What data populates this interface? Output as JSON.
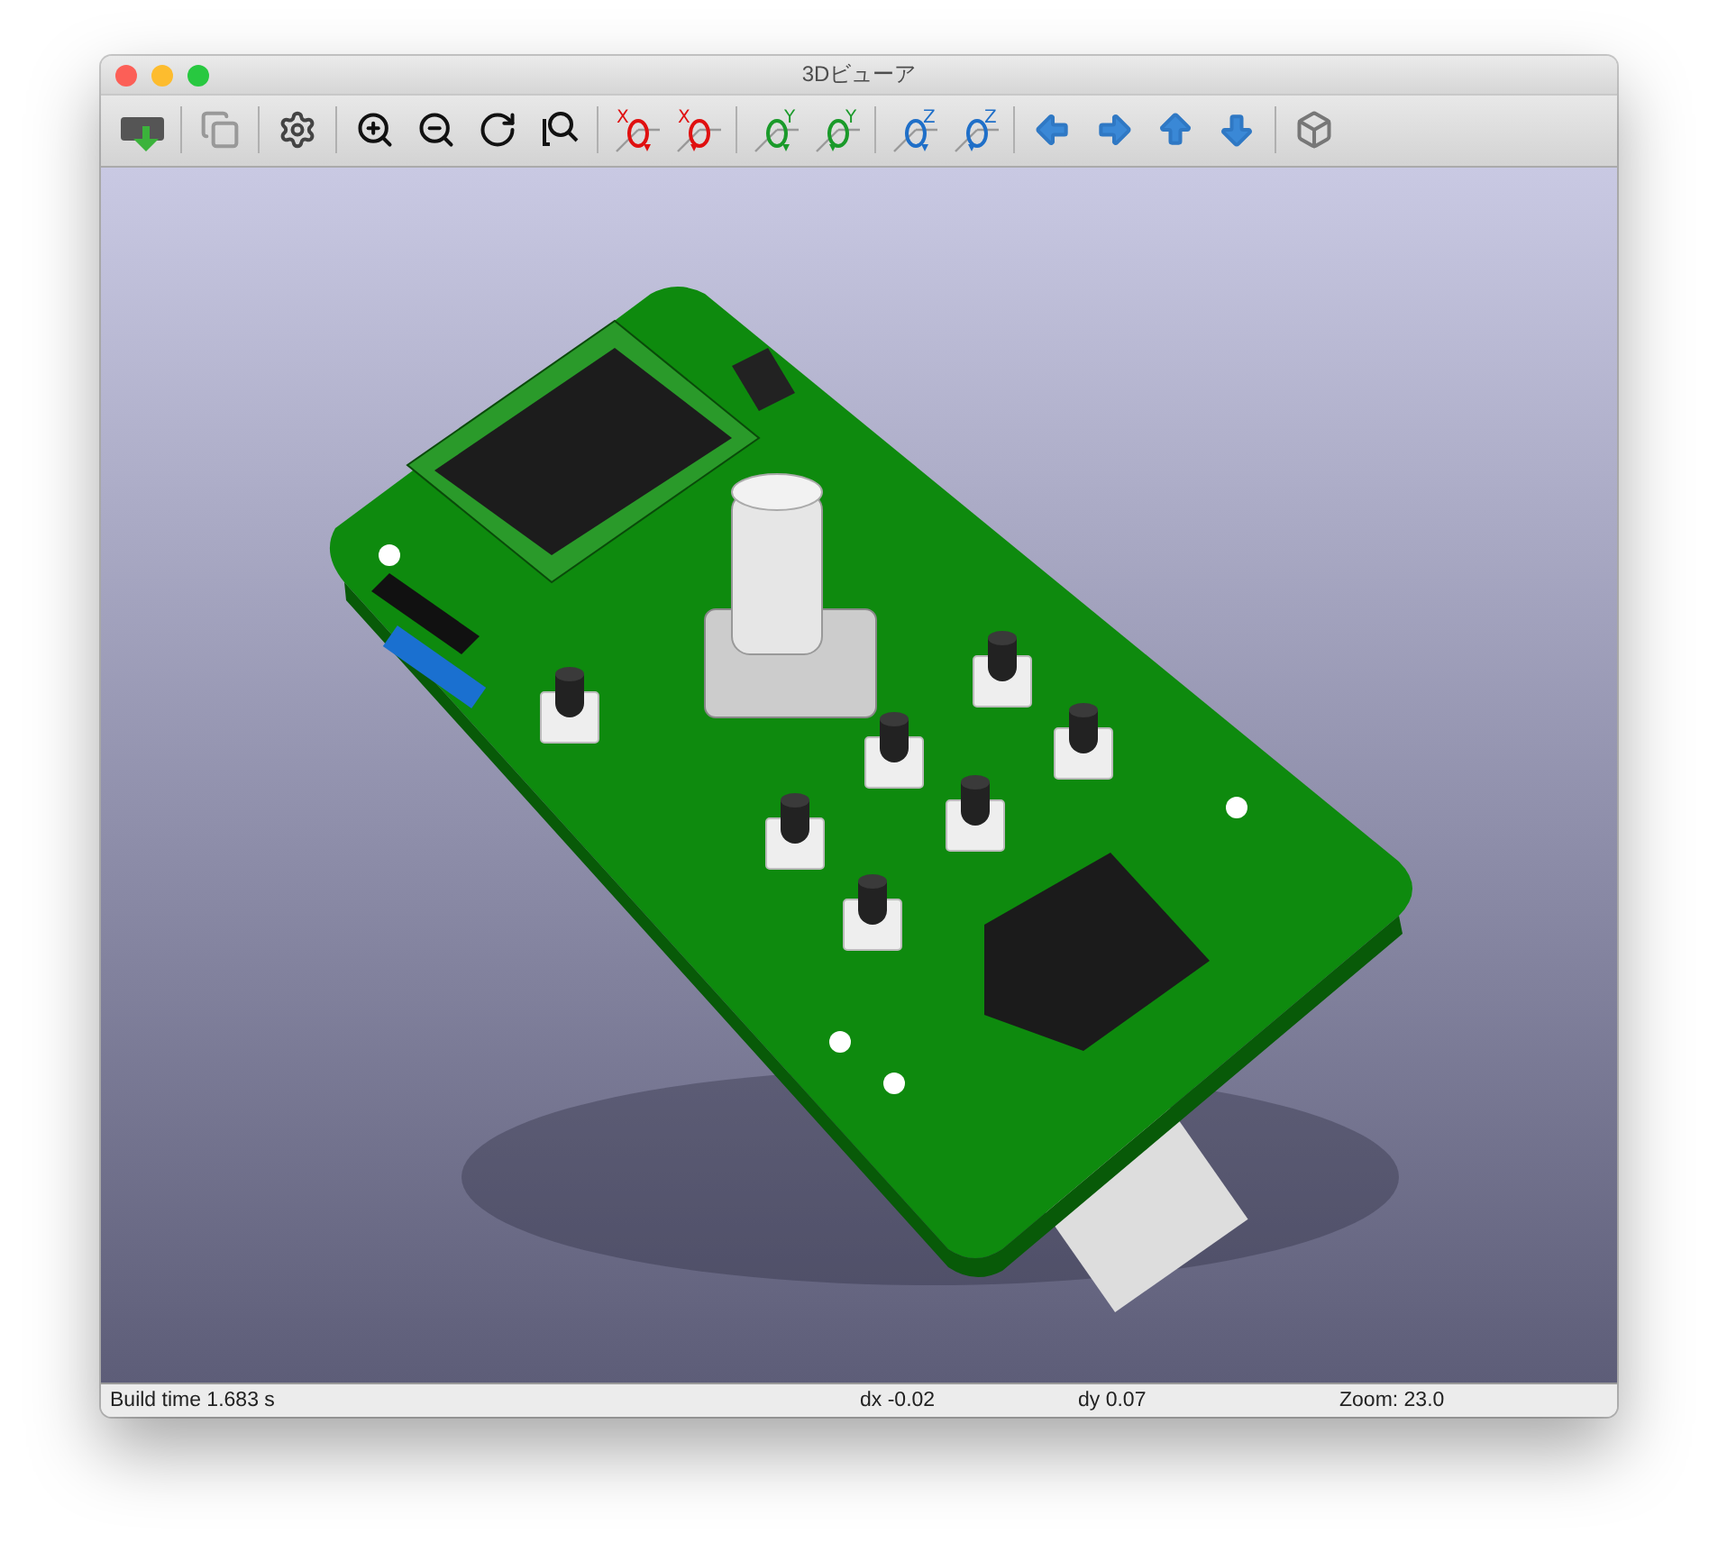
{
  "window": {
    "title": "3Dビューア"
  },
  "toolbar": [
    {
      "kind": "board"
    },
    {
      "kind": "sep"
    },
    {
      "kind": "copy"
    },
    {
      "kind": "sep"
    },
    {
      "kind": "settings"
    },
    {
      "kind": "sep"
    },
    {
      "kind": "zoom-in"
    },
    {
      "kind": "zoom-out"
    },
    {
      "kind": "redo"
    },
    {
      "kind": "zoom-fit"
    },
    {
      "kind": "sep"
    },
    {
      "kind": "rotate",
      "axis": "X",
      "clockwise": true
    },
    {
      "kind": "rotate",
      "axis": "X",
      "clockwise": false
    },
    {
      "kind": "sep"
    },
    {
      "kind": "rotate",
      "axis": "Y",
      "clockwise": true
    },
    {
      "kind": "rotate",
      "axis": "Y",
      "clockwise": false
    },
    {
      "kind": "sep"
    },
    {
      "kind": "rotate",
      "axis": "Z",
      "clockwise": true
    },
    {
      "kind": "rotate",
      "axis": "Z",
      "clockwise": false
    },
    {
      "kind": "sep"
    },
    {
      "kind": "left"
    },
    {
      "kind": "right"
    },
    {
      "kind": "up"
    },
    {
      "kind": "down"
    },
    {
      "kind": "sep"
    },
    {
      "kind": "cube"
    }
  ],
  "status_bar": {
    "build_time": "Build time 1.683 s",
    "dx": "dx -0.02",
    "dy": "dy 0.07",
    "zoom": "Zoom: 23.0"
  }
}
